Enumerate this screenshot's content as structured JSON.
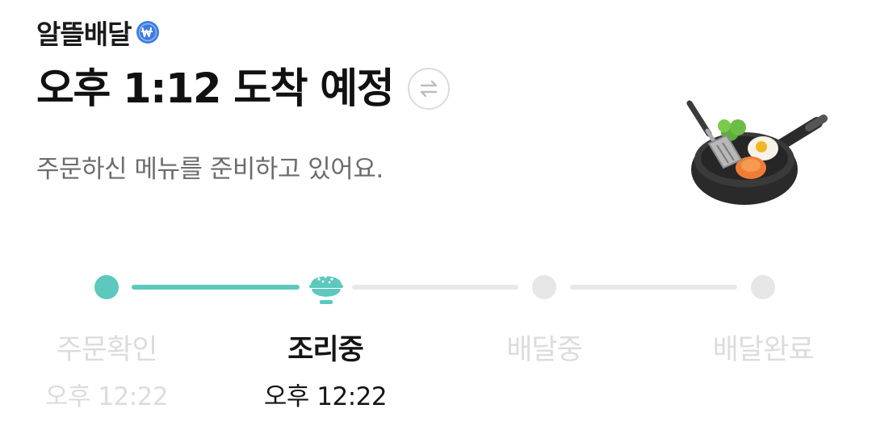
{
  "brand": {
    "name": "알뜰배달",
    "badge_icon": "won-coin-icon",
    "badge_color": "#3d7be0"
  },
  "delivery": {
    "eta_title": "오후 1:12 도착 예정",
    "swap_icon": "swap-arrows-icon",
    "status_message": "주문하신 메뉴를 준비하고 있어요.",
    "illustration": "frying-pan-icon"
  },
  "progress": {
    "accent_color": "#5dc8bd",
    "steps": [
      {
        "label": "주문확인",
        "time": "오후 12:22",
        "state": "done"
      },
      {
        "label": "조리중",
        "time": "오후 12:22",
        "state": "active",
        "icon": "rice-bowl-icon"
      },
      {
        "label": "배달중",
        "time": "",
        "state": "pending"
      },
      {
        "label": "배달완료",
        "time": "",
        "state": "pending"
      }
    ]
  }
}
